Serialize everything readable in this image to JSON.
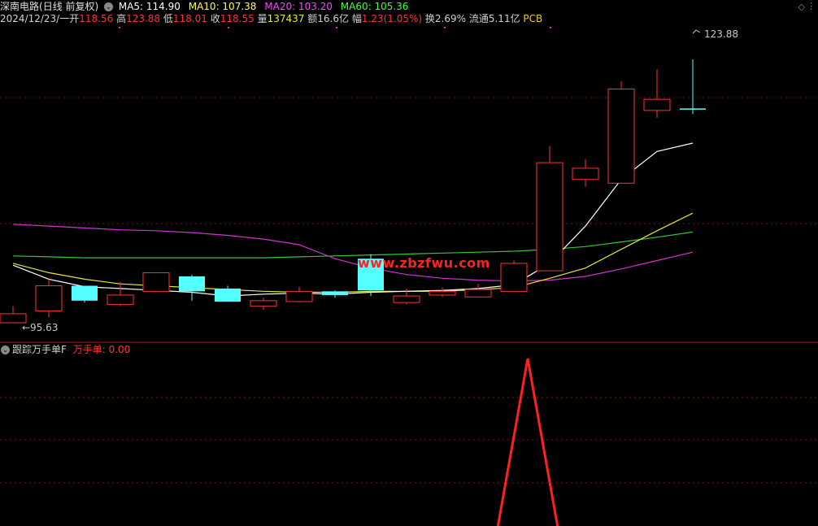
{
  "header": {
    "stock_name": "深南电路",
    "period_label": "(日线 前复权)",
    "ma": [
      {
        "label": "MA5: 114.90",
        "color": "#ffffff"
      },
      {
        "label": "MA10: 107.38",
        "color": "#ffff40"
      },
      {
        "label": "MA20: 103.20",
        "color": "#ff40ff"
      },
      {
        "label": "MA60: 105.36",
        "color": "#40ff40"
      }
    ]
  },
  "quote": {
    "date": "2024/12/23/一",
    "open_label": "开",
    "open": "118.56",
    "high_label": "高",
    "high": "123.88",
    "low_label": "低",
    "low": "118.01",
    "close_label": "收",
    "close": "118.55",
    "volume_label": "量",
    "volume": "137437",
    "amount_label": "额",
    "amount": "16.6亿",
    "change_label": "幅",
    "change": "1.23(1.05%)",
    "turnover_label": "换",
    "turnover": "2.69%",
    "float_label": "流通",
    "float": "5.11亿",
    "sector": "PCB"
  },
  "price_chart": {
    "max_label": "123.88",
    "min_label": "95.63",
    "watermark": "www.zbzfwu.com",
    "colors": {
      "up": "#ff3232",
      "down": "#54ffff",
      "ma5": "#ffffff",
      "ma10": "#e6e632",
      "ma20": "#d232d2",
      "ma60": "#32c832"
    },
    "candles": [
      {
        "o": 95.63,
        "h": 97.4,
        "l": 95.63,
        "c": 96.6
      },
      {
        "o": 96.9,
        "h": 100.3,
        "l": 96.2,
        "c": 99.6
      },
      {
        "o": 99.6,
        "h": 99.6,
        "l": 97.8,
        "c": 98.0
      },
      {
        "o": 97.6,
        "h": 100.0,
        "l": 97.4,
        "c": 98.6
      },
      {
        "o": 99.0,
        "h": 101.0,
        "l": 99.0,
        "c": 101.0
      },
      {
        "o": 100.6,
        "h": 100.8,
        "l": 98.0,
        "c": 99.0
      },
      {
        "o": 99.3,
        "h": 99.6,
        "l": 97.9,
        "c": 97.9
      },
      {
        "o": 97.4,
        "h": 98.3,
        "l": 97.0,
        "c": 98.0
      },
      {
        "o": 97.9,
        "h": 99.5,
        "l": 97.8,
        "c": 99.0
      },
      {
        "o": 99.0,
        "h": 99.1,
        "l": 98.3,
        "c": 98.6
      },
      {
        "o": 102.5,
        "h": 103.0,
        "l": 98.5,
        "c": 99.1
      },
      {
        "o": 97.8,
        "h": 99.3,
        "l": 97.6,
        "c": 98.5
      },
      {
        "o": 98.6,
        "h": 99.4,
        "l": 98.4,
        "c": 99.0
      },
      {
        "o": 98.4,
        "h": 99.8,
        "l": 98.4,
        "c": 99.2
      },
      {
        "o": 99.0,
        "h": 102.3,
        "l": 99.0,
        "c": 102.0
      },
      {
        "o": 101.2,
        "h": 114.6,
        "l": 101.2,
        "c": 112.8
      },
      {
        "o": 111.0,
        "h": 113.2,
        "l": 110.2,
        "c": 112.2
      },
      {
        "o": 110.6,
        "h": 121.5,
        "l": 110.6,
        "c": 120.7
      },
      {
        "o": 118.4,
        "h": 122.8,
        "l": 117.6,
        "c": 119.6
      },
      {
        "o": 118.56,
        "h": 123.88,
        "l": 118.01,
        "c": 118.55
      }
    ],
    "ma5": [
      101.8,
      100.3,
      99.5,
      99.3,
      99.1,
      98.9,
      98.5,
      98.7,
      98.8,
      98.7,
      98.9,
      99.0,
      99.1,
      99.3,
      99.7,
      102.0,
      106.0,
      111.0,
      114.0,
      114.9
    ],
    "ma10": [
      102.0,
      101.0,
      100.3,
      99.8,
      99.6,
      99.4,
      99.2,
      99.0,
      98.9,
      98.9,
      99.0,
      99.0,
      99.0,
      99.2,
      99.4,
      100.4,
      101.5,
      103.5,
      105.5,
      107.38
    ],
    "ma20": [
      106.2,
      106.0,
      105.8,
      105.6,
      105.5,
      105.3,
      105.0,
      104.6,
      104.0,
      102.5,
      101.5,
      100.8,
      100.4,
      100.2,
      100.1,
      100.2,
      100.6,
      101.4,
      102.3,
      103.2
    ],
    "ma60": [
      102.8,
      102.7,
      102.6,
      102.6,
      102.6,
      102.6,
      102.6,
      102.6,
      102.7,
      102.8,
      102.9,
      103.0,
      103.1,
      103.2,
      103.3,
      103.5,
      103.8,
      104.3,
      104.8,
      105.36
    ]
  },
  "indicator": {
    "name": "跟踪万手单F",
    "value_label": "万手单: 0.00",
    "values": [
      0,
      0,
      0,
      0,
      0,
      0,
      0,
      0,
      0,
      0,
      0,
      0,
      0,
      0,
      0,
      1,
      0,
      0,
      0,
      0
    ]
  }
}
